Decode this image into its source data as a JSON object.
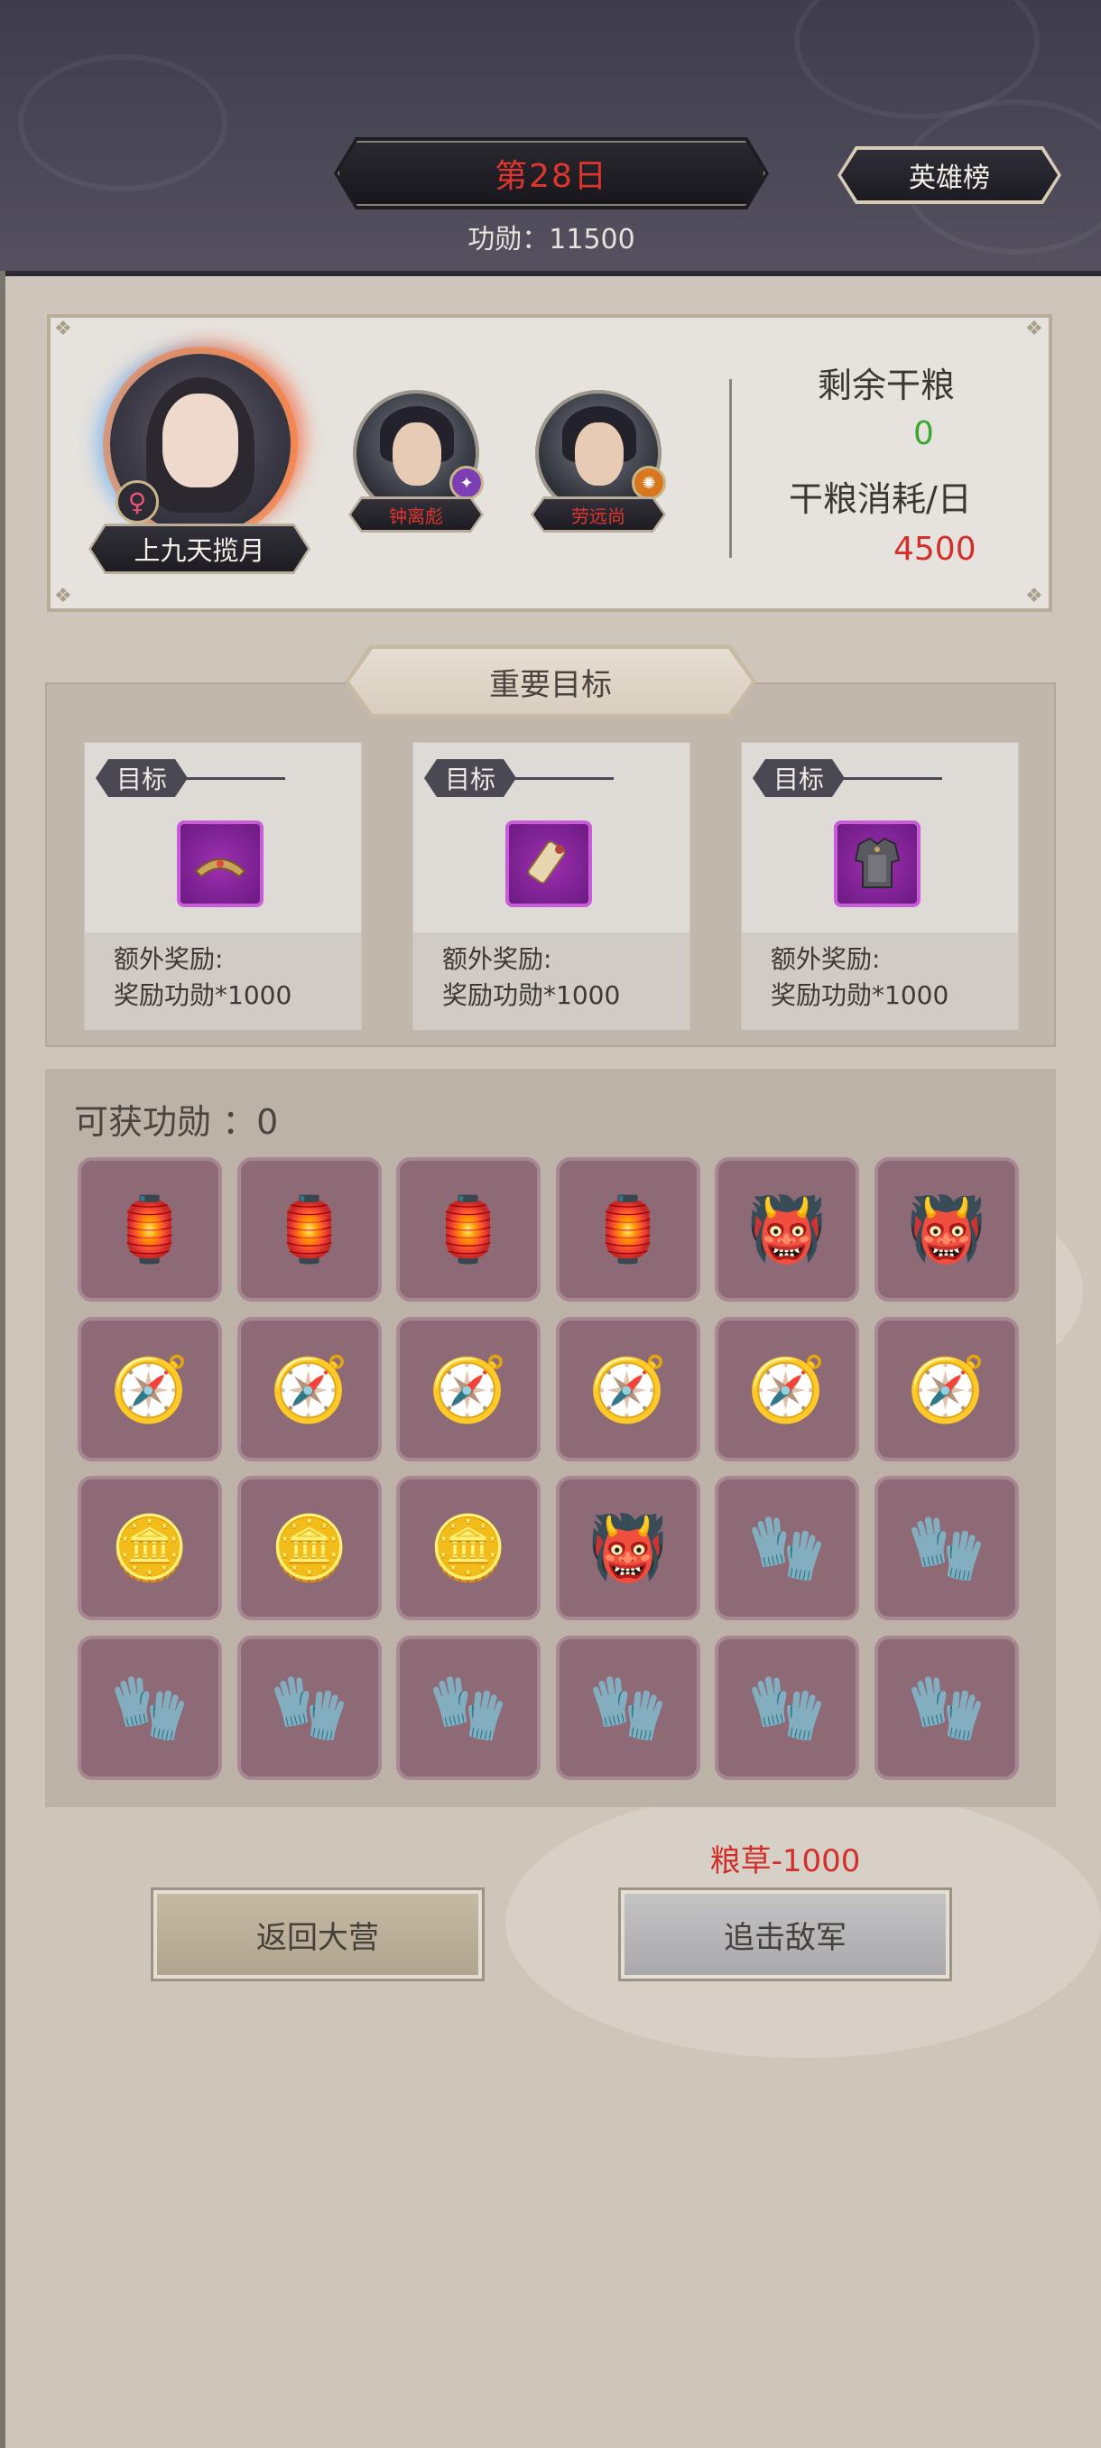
{
  "header": {
    "day_label": "第28日",
    "merit_text": "功勋：11500",
    "hero_rank_label": "英雄榜"
  },
  "hero_card": {
    "main_hero_name": "上九天揽月",
    "main_hero_gender_icon": "female-icon",
    "allies": [
      {
        "name": "钟离彪",
        "badge_icon": "purple-rank-icon",
        "badge_color": "#7b3fb3"
      },
      {
        "name": "劳远尚",
        "badge_icon": "orange-rank-icon",
        "badge_color": "#d7781e"
      }
    ],
    "remaining_rations_label": "剩余干粮",
    "remaining_rations_value": "0",
    "daily_consumption_label": "干粮消耗/日",
    "daily_consumption_value": "4500"
  },
  "goals": {
    "title": "重要目标",
    "cards": [
      {
        "tag": "目标",
        "item_icon": "bracer-icon",
        "reward_title": "额外奖励:",
        "reward_text": "奖励功勋*1000"
      },
      {
        "tag": "目标",
        "item_icon": "scroll-icon",
        "reward_title": "额外奖励:",
        "reward_text": "奖励功勋*1000"
      },
      {
        "tag": "目标",
        "item_icon": "armor-icon",
        "reward_title": "额外奖励:",
        "reward_text": "奖励功勋*1000"
      }
    ]
  },
  "loot": {
    "label": "可获功勋 ：0",
    "rows": [
      [
        "lantern-icon",
        "lantern-icon",
        "lantern-icon",
        "lantern-icon",
        "demon-mask-icon",
        "demon-mask-icon"
      ],
      [
        "compass-icon",
        "compass-icon",
        "compass-icon",
        "compass-icon",
        "compass-icon",
        "compass-icon"
      ],
      [
        "coin-icon",
        "coin-icon",
        "coin-icon",
        "demon-mask-icon",
        "gauntlet-icon",
        "gauntlet-icon"
      ],
      [
        "gauntlet-icon",
        "gauntlet-icon",
        "gauntlet-icon",
        "gauntlet-icon",
        "gauntlet-icon",
        "gauntlet-icon"
      ]
    ]
  },
  "actions": {
    "cost_text": "粮草-1000",
    "back_label": "返回大营",
    "chase_label": "追击敌军"
  },
  "colors": {
    "accent_red": "#e0352e",
    "value_green": "#3aa82f",
    "cell_purple": "#8d6a75"
  }
}
